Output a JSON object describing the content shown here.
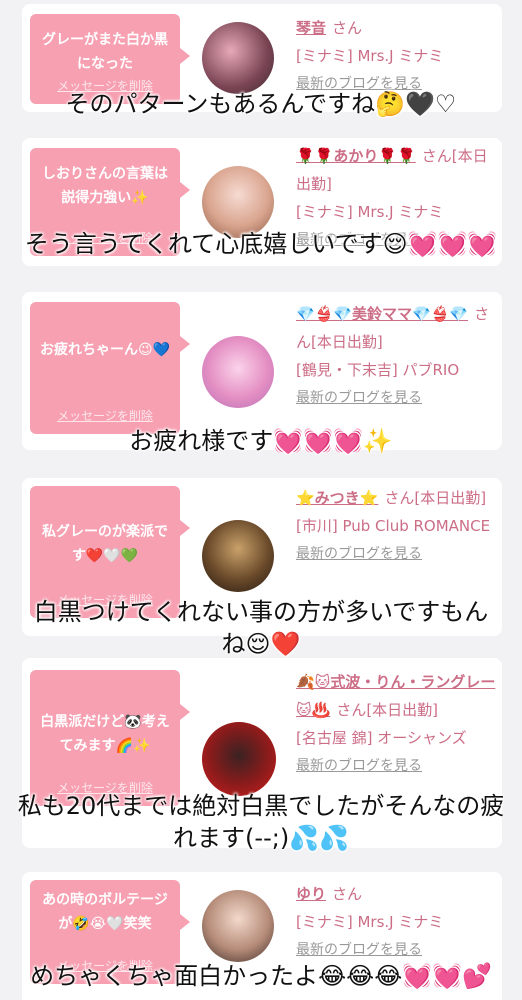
{
  "cards": [
    {
      "message": "グレーがまた白か黒になった",
      "delete": "メッセージを削除",
      "name": "琴音",
      "san": "さん",
      "shop": "[ミナミ] Mrs.J ミナミ",
      "blog": "最新のブログを見る"
    },
    {
      "message": "しおりさんの言葉は説得力強い✨",
      "delete": "メッセージを削除",
      "name": "🌹🌹あかり🌹🌹",
      "san": "さん[本日出勤]",
      "shop": "[ミナミ] Mrs.J ミナミ",
      "blog": "最新のブログを見る"
    },
    {
      "message": "お疲れちゃーん😉💙",
      "delete": "メッセージを削除",
      "name": "💎👙💎美鈴ママ💎👙💎",
      "san": "さん[本日出勤]",
      "shop": "[鶴見・下末吉] パブRIO",
      "blog": "最新のブログを見る"
    },
    {
      "message": "私グレーのが楽派です❤️🤍💚",
      "delete": "メッセージを削除",
      "name": "⭐みつき⭐",
      "san": "さん[本日出勤]",
      "shop": "[市川] Pub Club ROMANCE",
      "blog": "最新のブログを見る"
    },
    {
      "message": "白黒派だけど🐼考えてみます🌈✨",
      "delete": "メッセージを削除",
      "name": "🍂🐱式波・りん・ラングレー🐱♨️",
      "san": "さん[本日出勤]",
      "shop": "[名古屋 錦] オーシャンズ",
      "blog": "最新のブログを見る"
    },
    {
      "message": "あの時のボルテージが🤣😭🤍笑笑",
      "delete": "メッセージを削除",
      "name": "ゆり",
      "san": "さん",
      "shop": "[ミナミ] Mrs.J ミナミ",
      "blog": "最新のブログを見る"
    }
  ],
  "captions": [
    "そのパターンもあるんですね🤔🖤♡",
    "そう言うてくれて心底嬉しいです😌💓💓💓",
    "お疲れ様です💓💓💓✨",
    "白黒つけてくれない事の方が多いですもんね😌❤️",
    "私も20代までは絶対白黒でしたがそんなの疲れます(--;)💦💦",
    "めちゃくちゃ面白かったよ😂😂😂💓💓💕"
  ],
  "colors": {
    "bubble": "#f7a0b2",
    "name": "#cc6d86",
    "background": "#f2f2f4"
  }
}
